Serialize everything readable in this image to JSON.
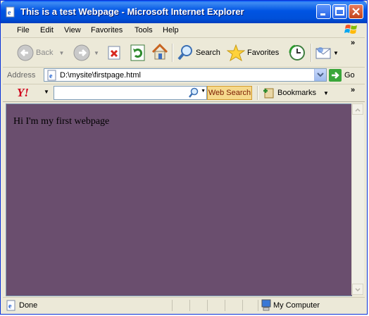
{
  "window": {
    "title": "This is a test Webpage - Microsoft Internet Explorer"
  },
  "menu": {
    "items": [
      "File",
      "Edit",
      "View",
      "Favorites",
      "Tools",
      "Help"
    ]
  },
  "toolbar": {
    "back_label": "Back",
    "search_label": "Search",
    "favorites_label": "Favorites",
    "more_chevron": "»"
  },
  "address": {
    "label": "Address",
    "url": "D:\\mysite\\firstpage.html",
    "go_label": "Go"
  },
  "yahoo": {
    "logo": "Y!",
    "search_button": "Web Search",
    "bookmarks_label": "Bookmarks",
    "more_chevron": "»"
  },
  "page": {
    "text": "Hi I'm my first webpage",
    "tile_colors": [
      "#5cdb5c",
      "#62c562",
      "#6e6e79",
      "#6a4e6e",
      "#9cff9c"
    ]
  },
  "status": {
    "text": "Done",
    "zone": "My Computer"
  }
}
